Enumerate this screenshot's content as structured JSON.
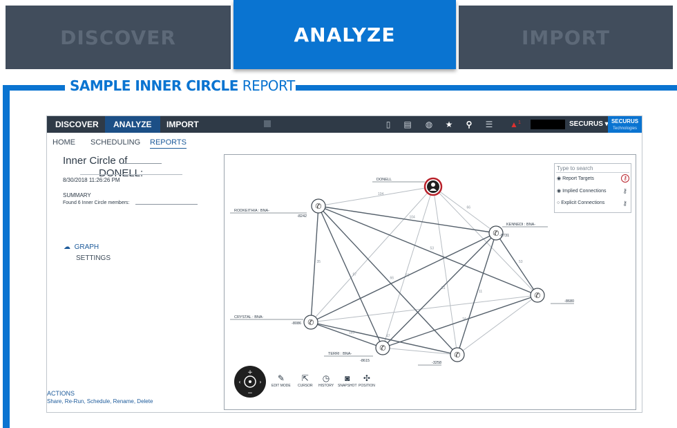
{
  "big_tabs": [
    "DISCOVER",
    "ANALYZE",
    "IMPORT"
  ],
  "section_title": {
    "bold": "SAMPLE INNER CIRCLE",
    "light": " REPORT"
  },
  "app": {
    "nav": [
      "DISCOVER",
      "ANALYZE",
      "IMPORT"
    ],
    "alert_count": "1",
    "user_menu": "SECURUS ▾",
    "brand_line1": "SECURUS",
    "brand_line2": "Technologies",
    "subnav": [
      "HOME",
      "SCHEDULING",
      "REPORTS"
    ]
  },
  "report": {
    "title_line1": "Inner Circle of",
    "title_line2": "DONELL:",
    "timestamp": "8/30/2018 11:26:26 PM",
    "summary_label": "SUMMARY",
    "found_text": "Found 6 Inner Circle members:",
    "graph_label": "GRAPH",
    "settings_label": "SETTINGS",
    "actions_label": "ACTIONS",
    "actions_links": "Share, Re-Run, Schedule, Rename, Delete"
  },
  "legend": {
    "search_placeholder": "Type to search",
    "rows": [
      "Report Targets",
      "Implied Connections",
      "Explicit Connections"
    ]
  },
  "graph": {
    "nodes": [
      {
        "id": "donell",
        "label": "DONELL",
        "suffix": ""
      },
      {
        "id": "rodkeithia",
        "label": "RODKEITHIA : BNA-",
        "suffix": "-8242"
      },
      {
        "id": "kennedi",
        "label": "KENNEDI : BNA-",
        "suffix": "-8731"
      },
      {
        "id": "right",
        "label": "",
        "suffix": "-8680"
      },
      {
        "id": "crystal",
        "label": "CRYSTAL : BNA-",
        "suffix": "-8086"
      },
      {
        "id": "terri",
        "label": "TERRI : BNA-",
        "suffix": "-8615"
      },
      {
        "id": "bottom",
        "label": "",
        "suffix": "-3258"
      }
    ],
    "edge_labels": [
      "104",
      "53",
      "35",
      "97",
      "66",
      "53",
      "51",
      "11",
      "185",
      "47",
      "74",
      "53",
      "104",
      "66"
    ]
  },
  "toolbar": {
    "tools": [
      "EDIT MODE",
      "CURSOR",
      "HISTORY",
      "SNAPSHOT",
      "POSITION"
    ]
  },
  "colors": {
    "accent_blue": "#0a74d1",
    "tab_gray": "#414d5c",
    "navbar": "#2f3a47",
    "alert_red": "#e0302f",
    "target_ring": "#b8212a"
  }
}
